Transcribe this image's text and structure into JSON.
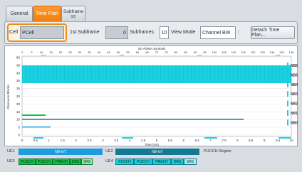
{
  "tabs": [
    {
      "label": "General",
      "sub": ""
    },
    {
      "label": "Time Plan",
      "sub": ""
    },
    {
      "label": "Subframe",
      "sub": "0/2"
    }
  ],
  "controls": {
    "cell_label": "Cell",
    "cell_value": "PCell",
    "first_subframe_label": "1st Subframe",
    "first_subframe_value": "0",
    "subframes_label": "Subframes",
    "subframes_value": "10",
    "view_mode_label": "View Mode",
    "view_mode_value": "Channel BW",
    "detach_button": "Detach Time Plan..."
  },
  "chart": {
    "top_axis_title": "SC-FDMA Symbols",
    "top_ticks": [
      "0",
      "5",
      "10",
      "15",
      "20",
      "25",
      "30",
      "35",
      "40",
      "45",
      "50",
      "55",
      "60",
      "65",
      "70",
      "75",
      "80",
      "85",
      "90",
      "95",
      "100",
      "105",
      "110",
      "115",
      "120",
      "125",
      "130",
      "135",
      "140"
    ],
    "slot_labels": [
      "subfr",
      "subfr",
      "subfr",
      "subfr"
    ],
    "y_axis_title": "Resource Blocks",
    "y_ticks": [
      "50",
      "45",
      "40",
      "35",
      "30",
      "25",
      "20",
      "15",
      "10",
      "5",
      "0"
    ],
    "x_axis_title": "Time (ms)",
    "x_ticks": [
      "0",
      "0.5",
      "1",
      "1.5",
      "2",
      "2.5",
      "3",
      "3.5",
      "4",
      "4.5",
      "5",
      "5.5",
      "6",
      "6.5",
      "7",
      "7.5",
      "8",
      "8.5",
      "9",
      "9.5",
      "10"
    ],
    "nb_labels": [
      "NB6",
      "NB5",
      "NB4",
      "NB3",
      "NB2",
      "NB1",
      "NB0"
    ]
  },
  "legend": {
    "ue1": "UE1",
    "ue2": "UE2",
    "ue3": "UE3",
    "ue4": "UE4",
    "ue1_bar": "NB-IoT",
    "ue2_bar": "NB-IoT",
    "pucch_region": "PUCCH Region",
    "ue3_cells": [
      "PUSCH",
      "PUCCH",
      "PRACH",
      "DRS",
      "SRS"
    ],
    "ue4_cells": [
      "PUSCH",
      "PUCCH",
      "PRACH",
      "DRS",
      "SRS"
    ]
  },
  "colors": {
    "accent": "#f08a1c",
    "cyan": "#1ad0e0",
    "ue1_blue": "#1e9ae0",
    "ue2_teal": "#127a94",
    "green": "#18c24a"
  }
}
